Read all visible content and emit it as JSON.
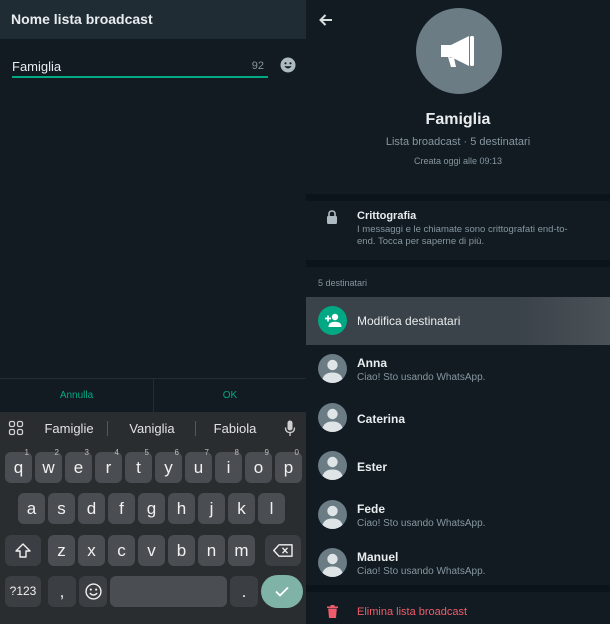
{
  "left": {
    "title": "Nome lista broadcast",
    "name_value": "Famiglia",
    "char_count": "92",
    "cancel_label": "Annulla",
    "ok_label": "OK",
    "suggestions": [
      "Famiglie",
      "Vaniglia",
      "Fabiola"
    ],
    "keyboard": {
      "row1": [
        {
          "k": "q",
          "h": "1"
        },
        {
          "k": "w",
          "h": "2"
        },
        {
          "k": "e",
          "h": "3"
        },
        {
          "k": "r",
          "h": "4"
        },
        {
          "k": "t",
          "h": "5"
        },
        {
          "k": "y",
          "h": "6"
        },
        {
          "k": "u",
          "h": "7"
        },
        {
          "k": "i",
          "h": "8"
        },
        {
          "k": "o",
          "h": "9"
        },
        {
          "k": "p",
          "h": "0"
        }
      ],
      "row2": [
        "a",
        "s",
        "d",
        "f",
        "g",
        "h",
        "j",
        "k",
        "l"
      ],
      "row3": [
        "z",
        "x",
        "c",
        "v",
        "b",
        "n",
        "m"
      ],
      "sym_label": "?123",
      "comma": ",",
      "period": "."
    }
  },
  "right": {
    "group_name": "Famiglia",
    "subtitle": "Lista broadcast · 5 destinatari",
    "created": "Creata oggi alle 09:13",
    "crypto_title": "Crittografia",
    "crypto_desc": "I messaggi e le chiamate sono crittografati end-to-end. Tocca per saperne di più.",
    "members_count": "5 destinatari",
    "edit_label": "Modifica destinatari",
    "members": [
      {
        "name": "Anna",
        "status": "Ciao! Sto usando WhatsApp."
      },
      {
        "name": "Caterina",
        "status": ""
      },
      {
        "name": "Ester",
        "status": ""
      },
      {
        "name": "Fede",
        "status": "Ciao! Sto usando WhatsApp."
      },
      {
        "name": "Manuel",
        "status": "Ciao! Sto usando WhatsApp."
      }
    ],
    "delete_label": "Elimina lista broadcast"
  },
  "colors": {
    "accent": "#00a884",
    "danger": "#f15c6d",
    "panel": "#121b22",
    "header": "#1f2c34"
  },
  "icons": [
    "back-arrow-icon",
    "megaphone-icon",
    "lock-icon",
    "add-person-icon",
    "person-icon",
    "trash-icon",
    "emoji-icon",
    "grid-icon",
    "microphone-icon",
    "shift-icon",
    "backspace-icon",
    "checkmark-icon"
  ]
}
